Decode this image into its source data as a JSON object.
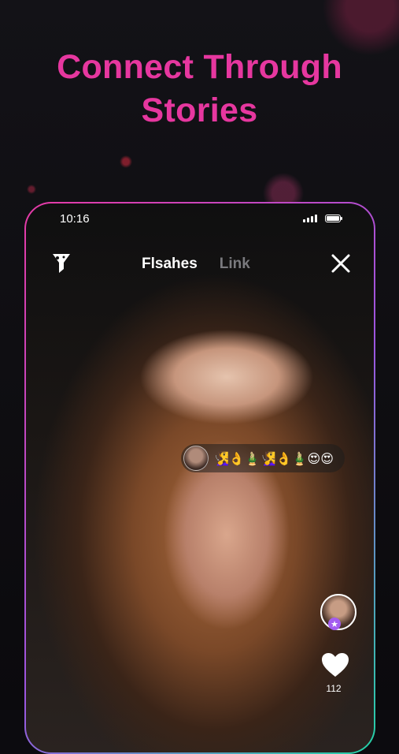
{
  "headline": {
    "line1": "Connect Through",
    "line2": "Stories"
  },
  "status_bar": {
    "time": "10:16"
  },
  "tabs": [
    {
      "label": "Flsahes",
      "active": true
    },
    {
      "label": "Link",
      "active": false
    }
  ],
  "comment": {
    "text": "🧏‍♀️👌🎍🧏‍♀️👌🎍😍😍"
  },
  "likes": {
    "count": "112"
  },
  "icons": {
    "filter": "filter-icon",
    "close": "close-icon",
    "like": "heart-icon",
    "badge": "star-badge-icon"
  },
  "colors": {
    "headline": "#e6379f",
    "frame_start": "#e63aa6",
    "frame_end": "#22d3a6",
    "badge": "#a45cf0"
  }
}
